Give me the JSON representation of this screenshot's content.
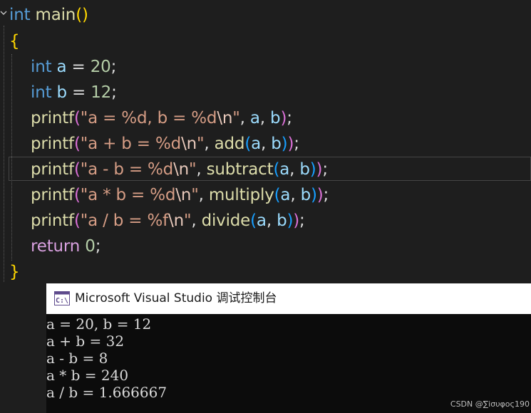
{
  "editor": {
    "lines": [
      [
        {
          "t": "int",
          "c": "kw"
        },
        {
          "t": " ",
          "c": "op"
        },
        {
          "t": "main",
          "c": "fn"
        },
        {
          "t": "()",
          "c": "p1"
        }
      ],
      [
        {
          "t": "{",
          "c": "p1"
        }
      ],
      [
        {
          "t": "int",
          "c": "kw"
        },
        {
          "t": " ",
          "c": "op"
        },
        {
          "t": "a",
          "c": "var"
        },
        {
          "t": " = ",
          "c": "op"
        },
        {
          "t": "20",
          "c": "num"
        },
        {
          "t": ";",
          "c": "op"
        }
      ],
      [
        {
          "t": "int",
          "c": "kw"
        },
        {
          "t": " ",
          "c": "op"
        },
        {
          "t": "b",
          "c": "var"
        },
        {
          "t": " = ",
          "c": "op"
        },
        {
          "t": "12",
          "c": "num"
        },
        {
          "t": ";",
          "c": "op"
        }
      ],
      [
        {
          "t": "printf",
          "c": "fn"
        },
        {
          "t": "(",
          "c": "p2"
        },
        {
          "t": "\"a = %d, b = %d",
          "c": "str"
        },
        {
          "t": "\\n",
          "c": "esc"
        },
        {
          "t": "\"",
          "c": "str"
        },
        {
          "t": ", ",
          "c": "op"
        },
        {
          "t": "a",
          "c": "var"
        },
        {
          "t": ", ",
          "c": "op"
        },
        {
          "t": "b",
          "c": "var"
        },
        {
          "t": ")",
          "c": "p2"
        },
        {
          "t": ";",
          "c": "op"
        }
      ],
      [
        {
          "t": "printf",
          "c": "fn"
        },
        {
          "t": "(",
          "c": "p2"
        },
        {
          "t": "\"a + b = %d",
          "c": "str"
        },
        {
          "t": "\\n",
          "c": "esc"
        },
        {
          "t": "\"",
          "c": "str"
        },
        {
          "t": ", ",
          "c": "op"
        },
        {
          "t": "add",
          "c": "fn"
        },
        {
          "t": "(",
          "c": "p3"
        },
        {
          "t": "a",
          "c": "var"
        },
        {
          "t": ", ",
          "c": "op"
        },
        {
          "t": "b",
          "c": "var"
        },
        {
          "t": ")",
          "c": "p3"
        },
        {
          "t": ")",
          "c": "p2"
        },
        {
          "t": ";",
          "c": "op"
        }
      ],
      [
        {
          "t": "printf",
          "c": "fn"
        },
        {
          "t": "(",
          "c": "p2"
        },
        {
          "t": "\"a - b = %d",
          "c": "str"
        },
        {
          "t": "\\n",
          "c": "esc"
        },
        {
          "t": "\"",
          "c": "str"
        },
        {
          "t": ", ",
          "c": "op"
        },
        {
          "t": "subtract",
          "c": "fn"
        },
        {
          "t": "(",
          "c": "p3"
        },
        {
          "t": "a",
          "c": "var"
        },
        {
          "t": ", ",
          "c": "op"
        },
        {
          "t": "b",
          "c": "var"
        },
        {
          "t": ")",
          "c": "p3"
        },
        {
          "t": ")",
          "c": "p2"
        },
        {
          "t": ";",
          "c": "op"
        }
      ],
      [
        {
          "t": "printf",
          "c": "fn"
        },
        {
          "t": "(",
          "c": "p2"
        },
        {
          "t": "\"a * b = %d",
          "c": "str"
        },
        {
          "t": "\\n",
          "c": "esc"
        },
        {
          "t": "\"",
          "c": "str"
        },
        {
          "t": ", ",
          "c": "op"
        },
        {
          "t": "multiply",
          "c": "fn"
        },
        {
          "t": "(",
          "c": "p3"
        },
        {
          "t": "a",
          "c": "var"
        },
        {
          "t": ", ",
          "c": "op"
        },
        {
          "t": "b",
          "c": "var"
        },
        {
          "t": ")",
          "c": "p3"
        },
        {
          "t": ")",
          "c": "p2"
        },
        {
          "t": ";",
          "c": "op"
        }
      ],
      [
        {
          "t": "printf",
          "c": "fn"
        },
        {
          "t": "(",
          "c": "p2"
        },
        {
          "t": "\"a / b = %f",
          "c": "str"
        },
        {
          "t": "\\n",
          "c": "esc"
        },
        {
          "t": "\"",
          "c": "str"
        },
        {
          "t": ", ",
          "c": "op"
        },
        {
          "t": "divide",
          "c": "fn"
        },
        {
          "t": "(",
          "c": "p3"
        },
        {
          "t": "a",
          "c": "var"
        },
        {
          "t": ", ",
          "c": "op"
        },
        {
          "t": "b",
          "c": "var"
        },
        {
          "t": ")",
          "c": "p3"
        },
        {
          "t": ")",
          "c": "p2"
        },
        {
          "t": ";",
          "c": "op"
        }
      ],
      [
        {
          "t": "return",
          "c": "ctl"
        },
        {
          "t": " ",
          "c": "op"
        },
        {
          "t": "0",
          "c": "num"
        },
        {
          "t": ";",
          "c": "op"
        }
      ],
      [
        {
          "t": "}",
          "c": "p1"
        }
      ]
    ],
    "fold_icon": "chevron-down-icon"
  },
  "console": {
    "title": "Microsoft Visual Studio 调试控制台",
    "icon": "console-app-icon",
    "output": [
      "a = 20, b = 12",
      "a + b = 32",
      "a - b = 8",
      "a * b = 240",
      "a / b = 1.666667"
    ]
  },
  "watermark": "CSDN @∑iσυφος190",
  "colors": {
    "background": "#1e1e1e",
    "keyword": "#569cd6",
    "function": "#dcdcaa",
    "variable": "#9cdcfe",
    "string": "#d69d85",
    "number": "#b5cea8"
  }
}
